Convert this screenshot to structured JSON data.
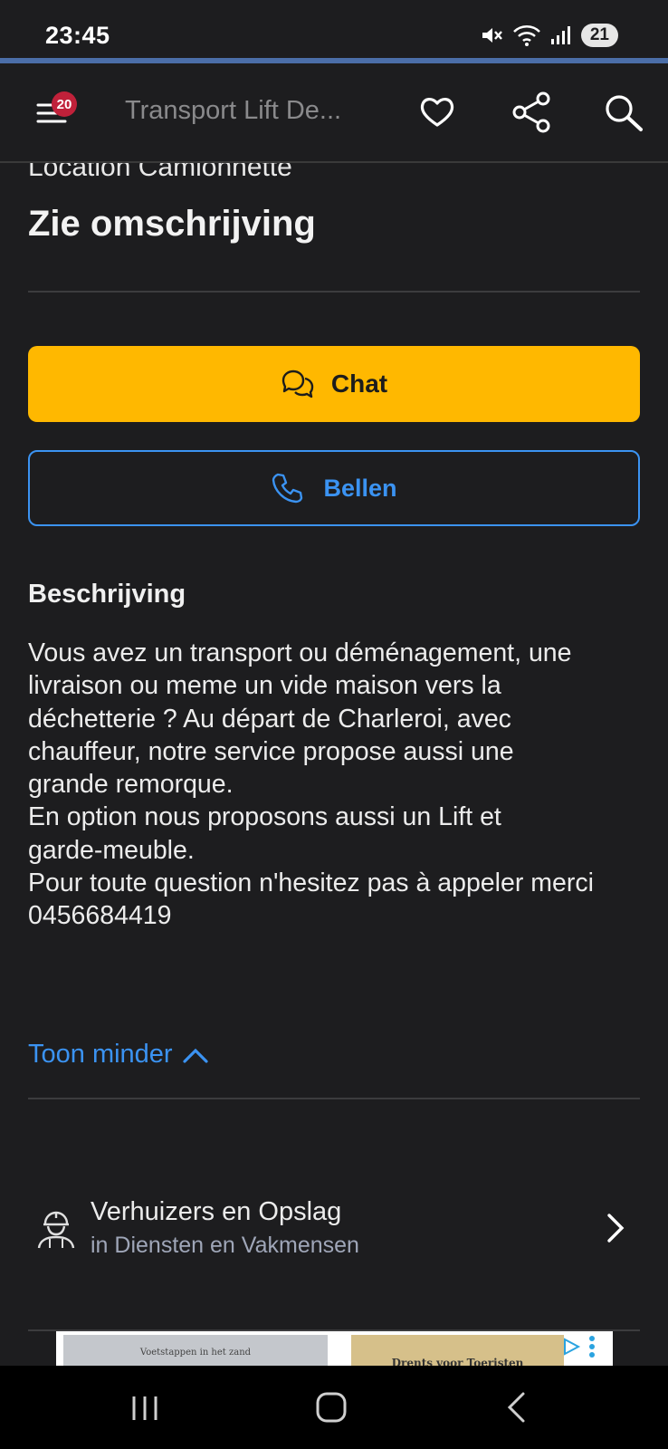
{
  "status_bar": {
    "time": "23:45",
    "battery": "21"
  },
  "app_bar": {
    "title": "Transport Lift De...",
    "notification_count": "20"
  },
  "listing": {
    "subtitle_partial": "Location Camionnette",
    "price": "Zie omschrijving"
  },
  "actions": {
    "chat_label": "Chat",
    "call_label": "Bellen"
  },
  "description": {
    "heading": "Beschrijving",
    "text": "Vous avez un transport ou déménagement, une\nlivraison ou meme un vide maison vers la\ndéchetterie ? Au départ de Charleroi, avec\nchauffeur, notre service propose aussi une\ngrande remorque.\nEn option nous proposons aussi un Lift et\ngarde-meuble.\nPour toute question n'hesitez pas à appeler merci\n0456684419",
    "toggle_label": "Toon minder"
  },
  "category": {
    "title": "Verhuizers en Opslag",
    "subtitle": "in Diensten en Vakmensen"
  },
  "ad": {
    "left_text": "Voetstappen in het zand",
    "right_text": "Drents voor Toeristen"
  },
  "colors": {
    "background": "#1d1d1f",
    "chat_button": "#ffb800",
    "link_blue": "#3b93f2",
    "badge_red": "#c0213a"
  },
  "icons": [
    "menu-icon",
    "heart-icon",
    "share-icon",
    "search-icon",
    "chat-icon",
    "phone-icon",
    "chevron-up-icon",
    "worker-icon",
    "chevron-right-icon"
  ]
}
